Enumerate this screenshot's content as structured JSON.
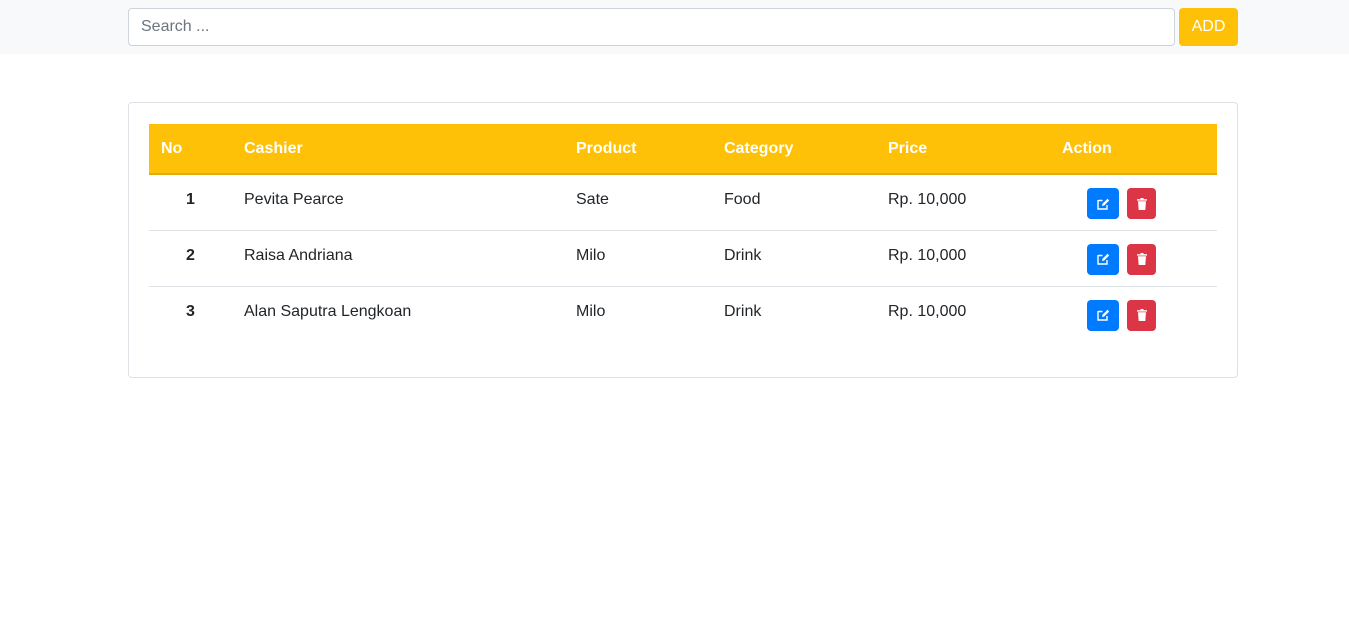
{
  "search": {
    "placeholder": "Search ..."
  },
  "toolbar": {
    "add_label": "ADD"
  },
  "table": {
    "headers": {
      "no": "No",
      "cashier": "Cashier",
      "product": "Product",
      "category": "Category",
      "price": "Price",
      "action": "Action"
    },
    "rows": [
      {
        "no": "1",
        "cashier": "Pevita Pearce",
        "product": "Sate",
        "category": "Food",
        "price": "Rp. 10,000"
      },
      {
        "no": "2",
        "cashier": "Raisa Andriana",
        "product": "Milo",
        "category": "Drink",
        "price": "Rp. 10,000"
      },
      {
        "no": "3",
        "cashier": "Alan Saputra Lengkoan",
        "product": "Milo",
        "category": "Drink",
        "price": "Rp. 10,000"
      }
    ],
    "row_actions": [
      "edit-icon",
      "trash-icon"
    ]
  },
  "colors": {
    "accent": "#ffc107",
    "edit": "#007bff",
    "delete": "#dc3545",
    "topbar": "#f8f9fa"
  }
}
